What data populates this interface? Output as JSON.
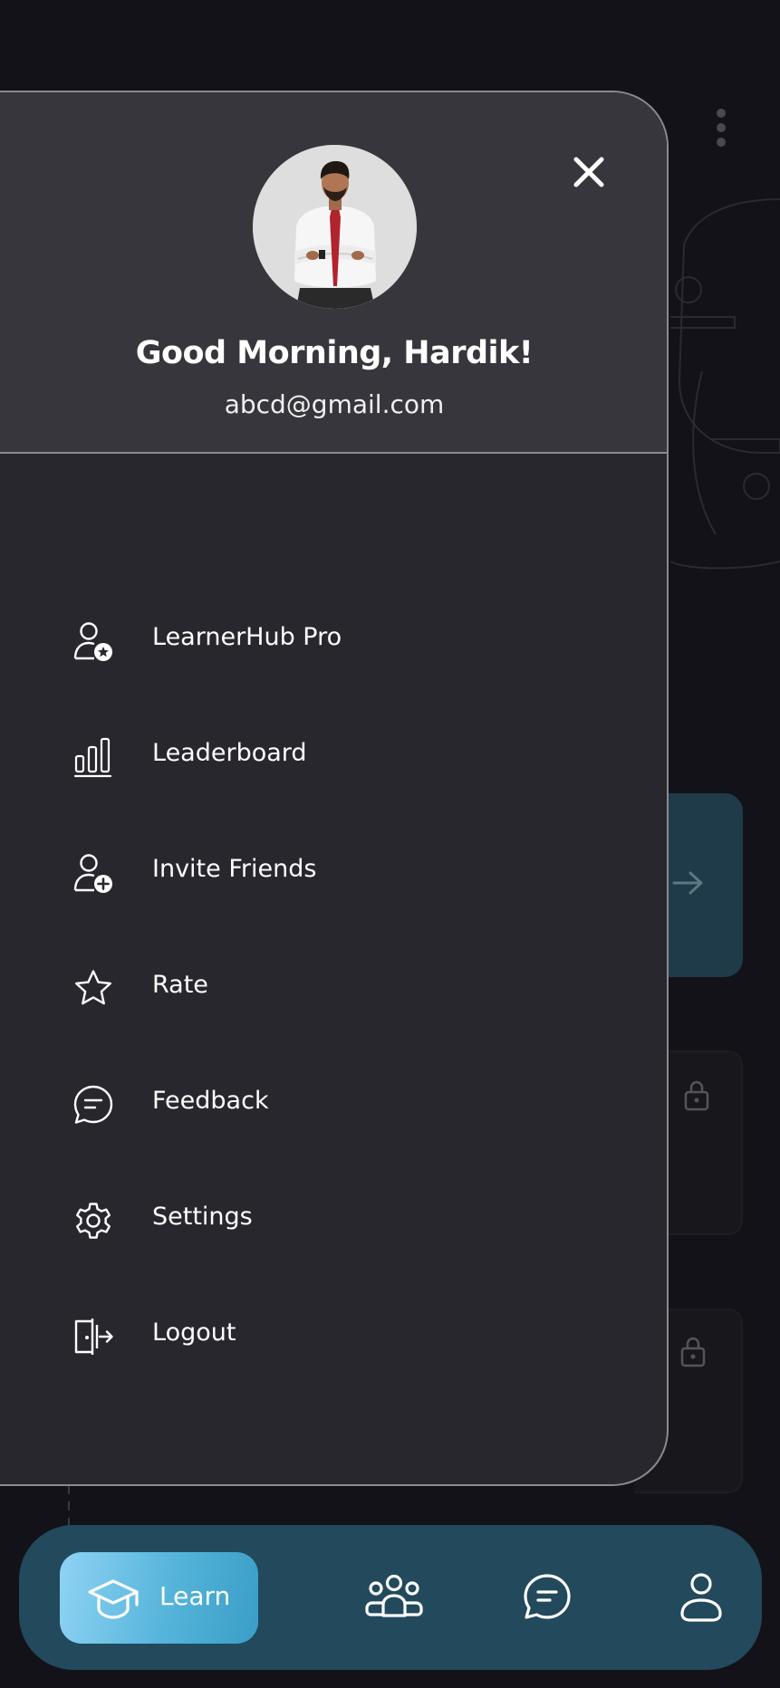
{
  "drawer": {
    "greeting": "Good Morning, Hardik!",
    "email": "abcd@gmail.com",
    "close_icon": "close-icon",
    "menu": [
      {
        "label": "LearnerHub Pro",
        "icon": "user-star-icon"
      },
      {
        "label": "Leaderboard",
        "icon": "bar-chart-icon"
      },
      {
        "label": "Invite Friends",
        "icon": "user-add-icon"
      },
      {
        "label": "Rate",
        "icon": "star-icon"
      },
      {
        "label": "Feedback",
        "icon": "message-icon"
      },
      {
        "label": "Settings",
        "icon": "gear-icon"
      },
      {
        "label": "Logout",
        "icon": "logout-icon"
      }
    ]
  },
  "bottom_nav": {
    "learn_label": "Learn",
    "items": [
      {
        "icon": "graduation-cap-icon",
        "active": true
      },
      {
        "icon": "community-icon",
        "active": false
      },
      {
        "icon": "chat-icon",
        "active": false
      },
      {
        "icon": "profile-icon",
        "active": false
      }
    ]
  },
  "colors": {
    "background": "#131218",
    "drawer": "#28272e",
    "drawer_header": "#37363c",
    "nav_bar": "#22495c",
    "accent": "#55b4da"
  }
}
